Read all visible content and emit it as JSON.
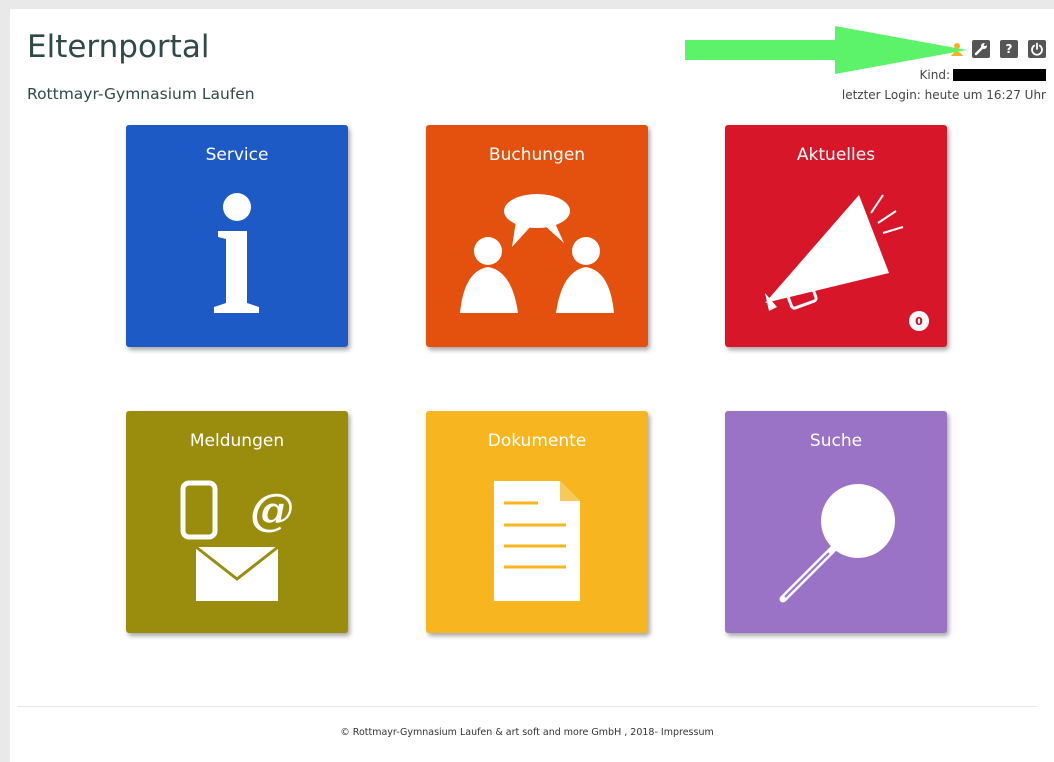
{
  "header": {
    "title": "Elternportal",
    "school": "Rottmayr-Gymnasium Laufen",
    "kind_label": "Kind:",
    "last_login": "letzter Login: heute um 16:27 Uhr",
    "icons": {
      "user": "user-icon",
      "settings": "wrench-icon",
      "help": "help-icon",
      "logout": "power-icon"
    },
    "help_glyph": "?"
  },
  "annotation": {
    "arrow_color": "#5cf26a"
  },
  "tiles": [
    {
      "label": "Service",
      "color": "#1e5ac5",
      "icon": "info-icon"
    },
    {
      "label": "Buchungen",
      "color": "#e4510f",
      "icon": "people-chat-icon"
    },
    {
      "label": "Aktuelles",
      "color": "#d8162a",
      "icon": "megaphone-icon",
      "badge": "0"
    },
    {
      "label": "Meldungen",
      "color": "#9a8d0e",
      "icon": "messages-icon"
    },
    {
      "label": "Dokumente",
      "color": "#f7b520",
      "icon": "document-icon"
    },
    {
      "label": "Suche",
      "color": "#9a73c6",
      "icon": "magnifier-icon"
    }
  ],
  "footer": {
    "copyright": "© Rottmayr-Gymnasium Laufen & art soft and more GmbH , 2018-",
    "impressum": "Impressum"
  }
}
